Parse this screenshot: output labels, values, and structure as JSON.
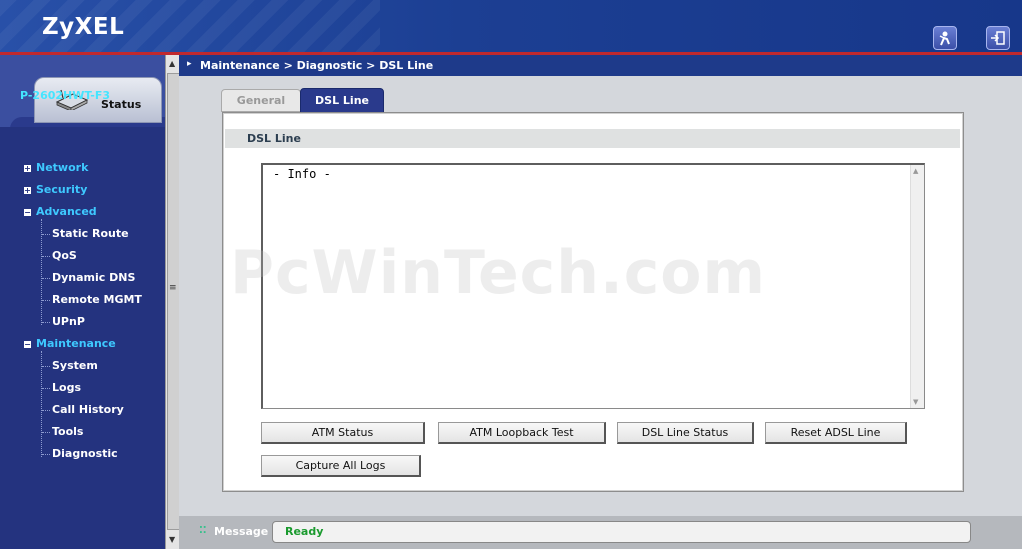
{
  "header": {
    "logo": "ZyXEL",
    "wizard_icon": "wizard-icon",
    "logout_icon": "logout-icon"
  },
  "sidebar": {
    "status_tab": "Status",
    "device_name": "P-2602HWT-F3",
    "items": [
      {
        "label": "Network",
        "level": 0,
        "expander": "+"
      },
      {
        "label": "Security",
        "level": 0,
        "expander": "+"
      },
      {
        "label": "Advanced",
        "level": 0,
        "expander": "-"
      },
      {
        "label": "Static Route",
        "level": 1
      },
      {
        "label": "QoS",
        "level": 1
      },
      {
        "label": "Dynamic DNS",
        "level": 1
      },
      {
        "label": "Remote MGMT",
        "level": 1
      },
      {
        "label": "UPnP",
        "level": 1
      },
      {
        "label": "Maintenance",
        "level": 0,
        "expander": "-"
      },
      {
        "label": "System",
        "level": 1
      },
      {
        "label": "Logs",
        "level": 1
      },
      {
        "label": "Call History",
        "level": 1
      },
      {
        "label": "Tools",
        "level": 1
      },
      {
        "label": "Diagnostic",
        "level": 1
      }
    ]
  },
  "breadcrumb": "Maintenance > Diagnostic > DSL Line",
  "tabs": [
    {
      "label": "General",
      "active": false
    },
    {
      "label": "DSL Line",
      "active": true
    }
  ],
  "section": {
    "title": "DSL Line",
    "info_text": "- Info -"
  },
  "buttons": {
    "atm_status": "ATM Status",
    "atm_loopback": "ATM Loopback Test",
    "dsl_line_status": "DSL Line Status",
    "reset_adsl": "Reset ADSL Line",
    "capture_logs": "Capture All Logs"
  },
  "statusbar": {
    "label": "Message",
    "value": "Ready"
  },
  "watermark": "PcWinTech.com",
  "colors": {
    "header_bg": "#1a3c8c",
    "accent_red": "#c0292e",
    "nav_top": "#3ec9ff",
    "ready_green": "#1a9a2e"
  }
}
